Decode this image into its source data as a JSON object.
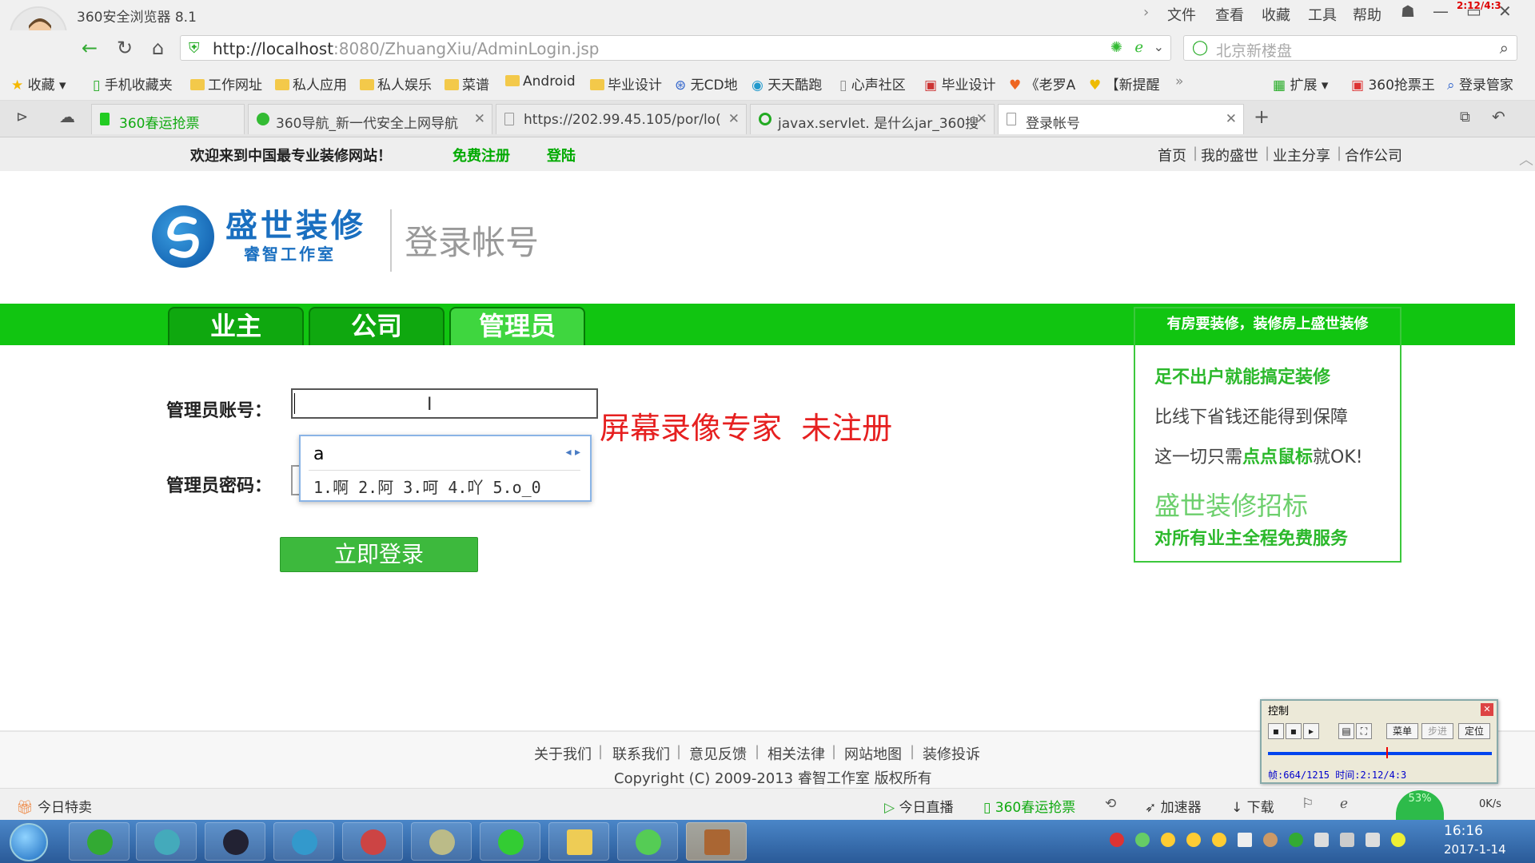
{
  "browser": {
    "title": "360安全浏览器 8.1",
    "menu": [
      "文件",
      "查看",
      "收藏",
      "工具",
      "帮助"
    ],
    "corner_text": "2:12/4:3",
    "url_host": "http://localhost",
    "url_rest": ":8080/ZhuangXiu/AdminLogin.jsp",
    "search_placeholder": "北京新楼盘",
    "bookmarks": [
      "收藏",
      "手机收藏夹",
      "工作网址",
      "私人应用",
      "私人娱乐",
      "菜谱",
      "Android",
      "毕业设计",
      "无CD地",
      "天天酷跑",
      "心声社区",
      "毕业设计",
      "《老罗A",
      "【新提醒"
    ],
    "bookmarks_right": [
      "扩展",
      "360抢票王",
      "登录管家"
    ],
    "tabs": [
      {
        "label": "360春运抢票"
      },
      {
        "label": "360导航_新一代安全上网导航"
      },
      {
        "label": "https://202.99.45.105/por/lo("
      },
      {
        "label": "javax.servlet. 是什么jar_360搜"
      },
      {
        "label": "登录帐号"
      }
    ]
  },
  "page": {
    "welcome": "欢迎来到中国最专业装修网站！",
    "register": "免费注册",
    "login_link": "登陆",
    "top_nav": [
      "首页",
      "我的盛世",
      "业主分享",
      "合作公司"
    ],
    "logo_name": "盛世装修",
    "logo_sub": "睿智工作室",
    "page_heading": "登录帐号",
    "role_tabs": [
      "业主",
      "公司",
      "管理员"
    ],
    "account_label": "管理员账号：",
    "password_label": "管理员密码：",
    "ime_input": "a",
    "ime_candidates": "1.啊  2.阿  3.呵  4.吖  5.o_0",
    "watermark": "屏幕录像专家  未注册",
    "login_button": "立即登录",
    "side": {
      "header": "有房要装修，装修房上盛世装修",
      "line1": "足不出户就能搞定装修",
      "line2": "比线下省钱还能得到保障",
      "line3_a": "这一切只需",
      "line3_b": "点点鼠标",
      "line3_c": "就OK!",
      "line4": "盛世装修招标",
      "line5": "对所有业主全程免费服务"
    },
    "footer_links": [
      "关于我们",
      "联系我们",
      "意见反馈",
      "相关法律",
      "网站地图",
      "装修投诉"
    ],
    "copyright": "Copyright (C) 2009-2013 睿智工作室  版权所有"
  },
  "control": {
    "title": "控制",
    "btn_menu": "菜单",
    "btn_step": "步进",
    "btn_locate": "定位",
    "status": "帧:664/1215 时间:2:12/4:3"
  },
  "statusbar": {
    "left": "今日特卖",
    "items": [
      "今日直播",
      "360春运抢票",
      "加速器",
      "下载"
    ],
    "speed": "0K/s",
    "percent": "53%"
  },
  "taskbar": {
    "time": "16:16",
    "date": "2017-1-14"
  },
  "colors": {
    "green": "#11c511",
    "red_watermark": "#e62020",
    "logo_blue": "#1a6fc0"
  }
}
